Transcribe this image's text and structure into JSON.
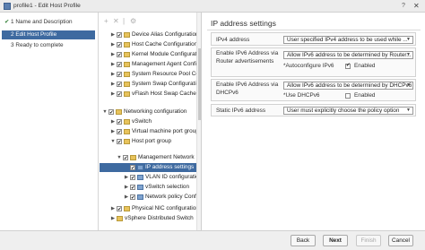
{
  "window": {
    "title": "profile1 - Edit Host Profile"
  },
  "steps": [
    {
      "label": "1 Name and Description",
      "done": true
    },
    {
      "label": "2 Edit Host Profile",
      "active": true
    },
    {
      "label": "3 Ready to complete"
    }
  ],
  "tree": {
    "items": [
      {
        "label": "Device Alias Configuration",
        "icon": "folder-icon"
      },
      {
        "label": "Host Cache Configuration",
        "icon": "folder-icon"
      },
      {
        "label": "Kernel Module Configuration",
        "icon": "folder-icon"
      },
      {
        "label": "Management Agent Configuration",
        "icon": "folder-icon"
      },
      {
        "label": "System Resource Pool Configuration",
        "icon": "folder-icon"
      },
      {
        "label": "System Swap Configuration",
        "icon": "folder-icon"
      },
      {
        "label": "vFlash Host Swap Cache Configuration",
        "icon": "folder-icon"
      },
      {
        "label": "Networking configuration",
        "icon": "folder-icon"
      },
      {
        "label": "vSwitch",
        "icon": "folder-icon"
      },
      {
        "label": "Virtual machine port group",
        "icon": "folder-icon"
      },
      {
        "label": "Host port group",
        "icon": "folder-icon"
      },
      {
        "label": "Management Network",
        "icon": "folder-icon"
      },
      {
        "label": "IP address settings",
        "icon": "settings-icon",
        "selected": true
      },
      {
        "label": "VLAN ID configuration",
        "icon": "settings-icon"
      },
      {
        "label": "vSwitch selection",
        "icon": "settings-icon"
      },
      {
        "label": "Network policy Configuration",
        "icon": "settings-icon"
      },
      {
        "label": "Physical NIC configuration",
        "icon": "folder-icon"
      },
      {
        "label": "vSphere Distributed Switch",
        "icon": "folder-icon"
      }
    ]
  },
  "panel": {
    "title": "IP address settings",
    "ipv4": {
      "label": "IPv4 address",
      "value": "User specified IPv4 address to be used while ..."
    },
    "ra": {
      "label": "Enable IPv6 Address via Router advertisements",
      "value": "Allow IPv6 address to be determined by Router...",
      "sub_label": "*Autoconfigure IPv6",
      "checkbox_label": "Enabled",
      "checked": true
    },
    "dhcp": {
      "label": "Enable IPv6 Address via DHCPv6",
      "value": "Allow IPv6 address to be determined by DHCPv6",
      "sub_label": "*Use DHCPv6",
      "checkbox_label": "Enabled",
      "checked": false
    },
    "static": {
      "label": "Static IPv6 address",
      "value": "User must explicitly choose the policy option"
    }
  },
  "footer": {
    "back": "Back",
    "next": "Next",
    "finish": "Finish",
    "cancel": "Cancel"
  }
}
